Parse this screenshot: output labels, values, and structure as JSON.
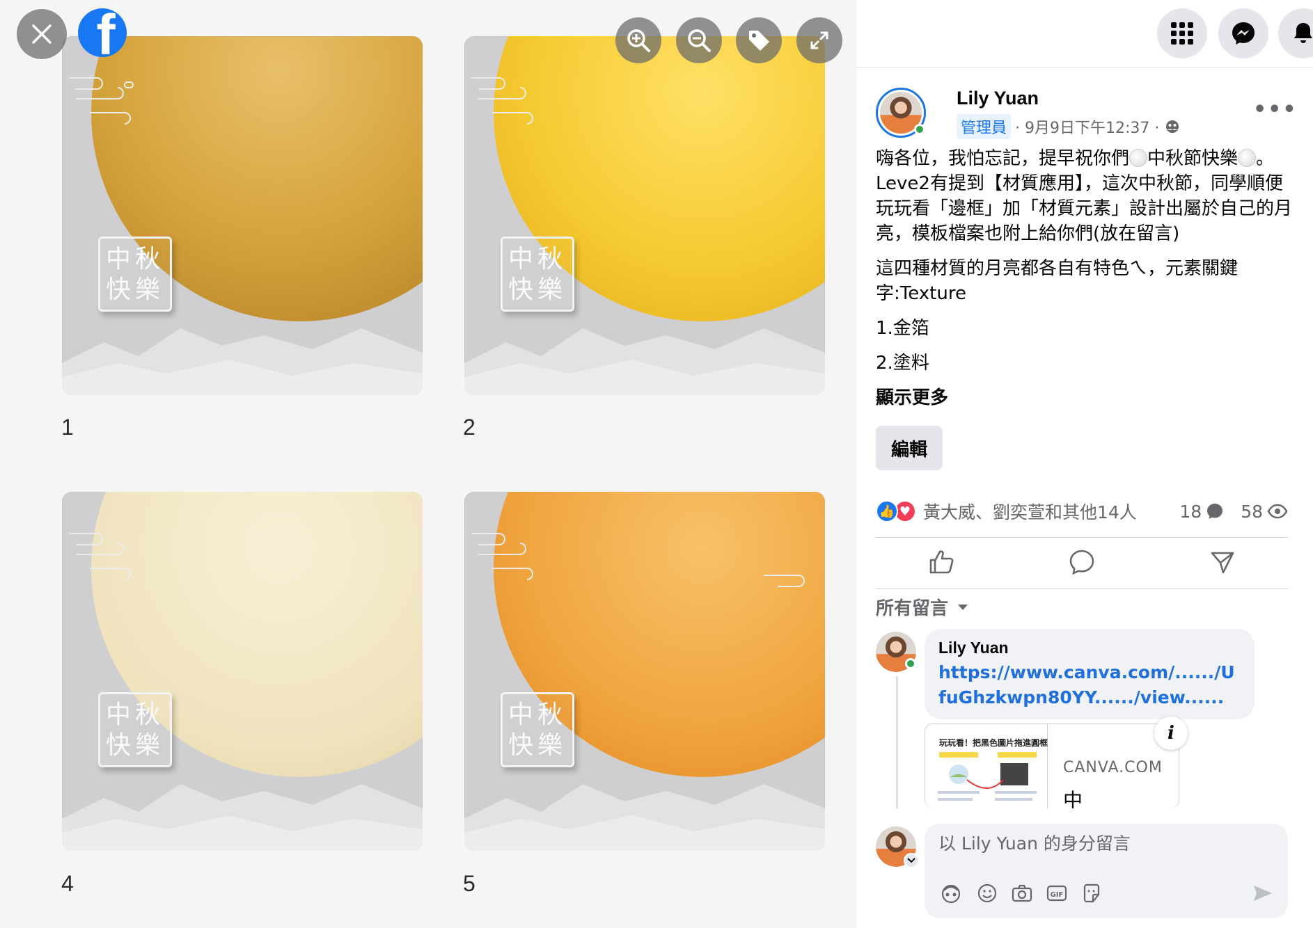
{
  "viewer": {
    "close_icon": "close-icon",
    "logo": "facebook-logo",
    "tools": [
      "zoom-in-icon",
      "zoom-out-icon",
      "tag-icon",
      "fullscreen-icon"
    ],
    "tiles": [
      {
        "num": "1",
        "stamp_line1": "中秋",
        "stamp_line2": "快樂",
        "texture": "gold-foil"
      },
      {
        "num": "2",
        "stamp_line1": "中秋",
        "stamp_line2": "快樂",
        "texture": "yellow-paint"
      },
      {
        "num": "4",
        "stamp_line1": "中秋",
        "stamp_line2": "快樂",
        "texture": "cream-paper"
      },
      {
        "num": "5",
        "stamp_line1": "中秋",
        "stamp_line2": "快樂",
        "texture": "orange-watercolor"
      }
    ]
  },
  "topbar": {
    "icons": [
      "menu-grid-icon",
      "messenger-icon",
      "notifications-bell-icon"
    ]
  },
  "post": {
    "author": "Lily Yuan",
    "badge": "管理員",
    "time": "· 9月9日下午12:37 ·",
    "privacy_icon": "group-privacy-icon",
    "body": {
      "p1a": "嗨各位，我怕忘記，提早祝你們",
      "p1b": "中秋節快樂",
      "p1c": "。Leve2有提到【材質應用】，這次中秋節，同學順便玩玩看「邊框」加「材質元素」設計出屬於自己的月亮，模板檔案也附上給你們(放在留言)",
      "p2": "這四種材質的月亮都各自有特色ㄟ，元素關鍵字:Texture",
      "p3": "1.金箔",
      "p4": "2.塗料",
      "see_more": "顯示更多"
    },
    "edit_label": "編輯",
    "reactions": {
      "names": "黃大威、劉奕萱和其他14人",
      "comments": "18",
      "views": "58"
    },
    "actions": [
      "like-icon",
      "comment-icon",
      "share-icon"
    ]
  },
  "comments": {
    "sort_label": "所有留言",
    "items": [
      {
        "author": "Lily Yuan",
        "link": "https://www.canva.com/....../UfuGhzkwpn80YY....../view......",
        "preview": {
          "title": "玩玩看！把黑色圖片拖進圓框",
          "domain": "CANVA.COM",
          "text": "中"
        }
      }
    ],
    "compose": {
      "placeholder": "以 Lily Yuan 的身分留言",
      "icons": [
        "avatar-sticker-icon",
        "emoji-icon",
        "camera-icon",
        "gif-icon",
        "sticker-icon",
        "send-icon"
      ]
    }
  },
  "colors": {
    "accent": "#1877f2",
    "gold": "#d9a93a",
    "yellow": "#f2c32a",
    "cream": "#f0e4c4",
    "orange": "#efa13c"
  }
}
